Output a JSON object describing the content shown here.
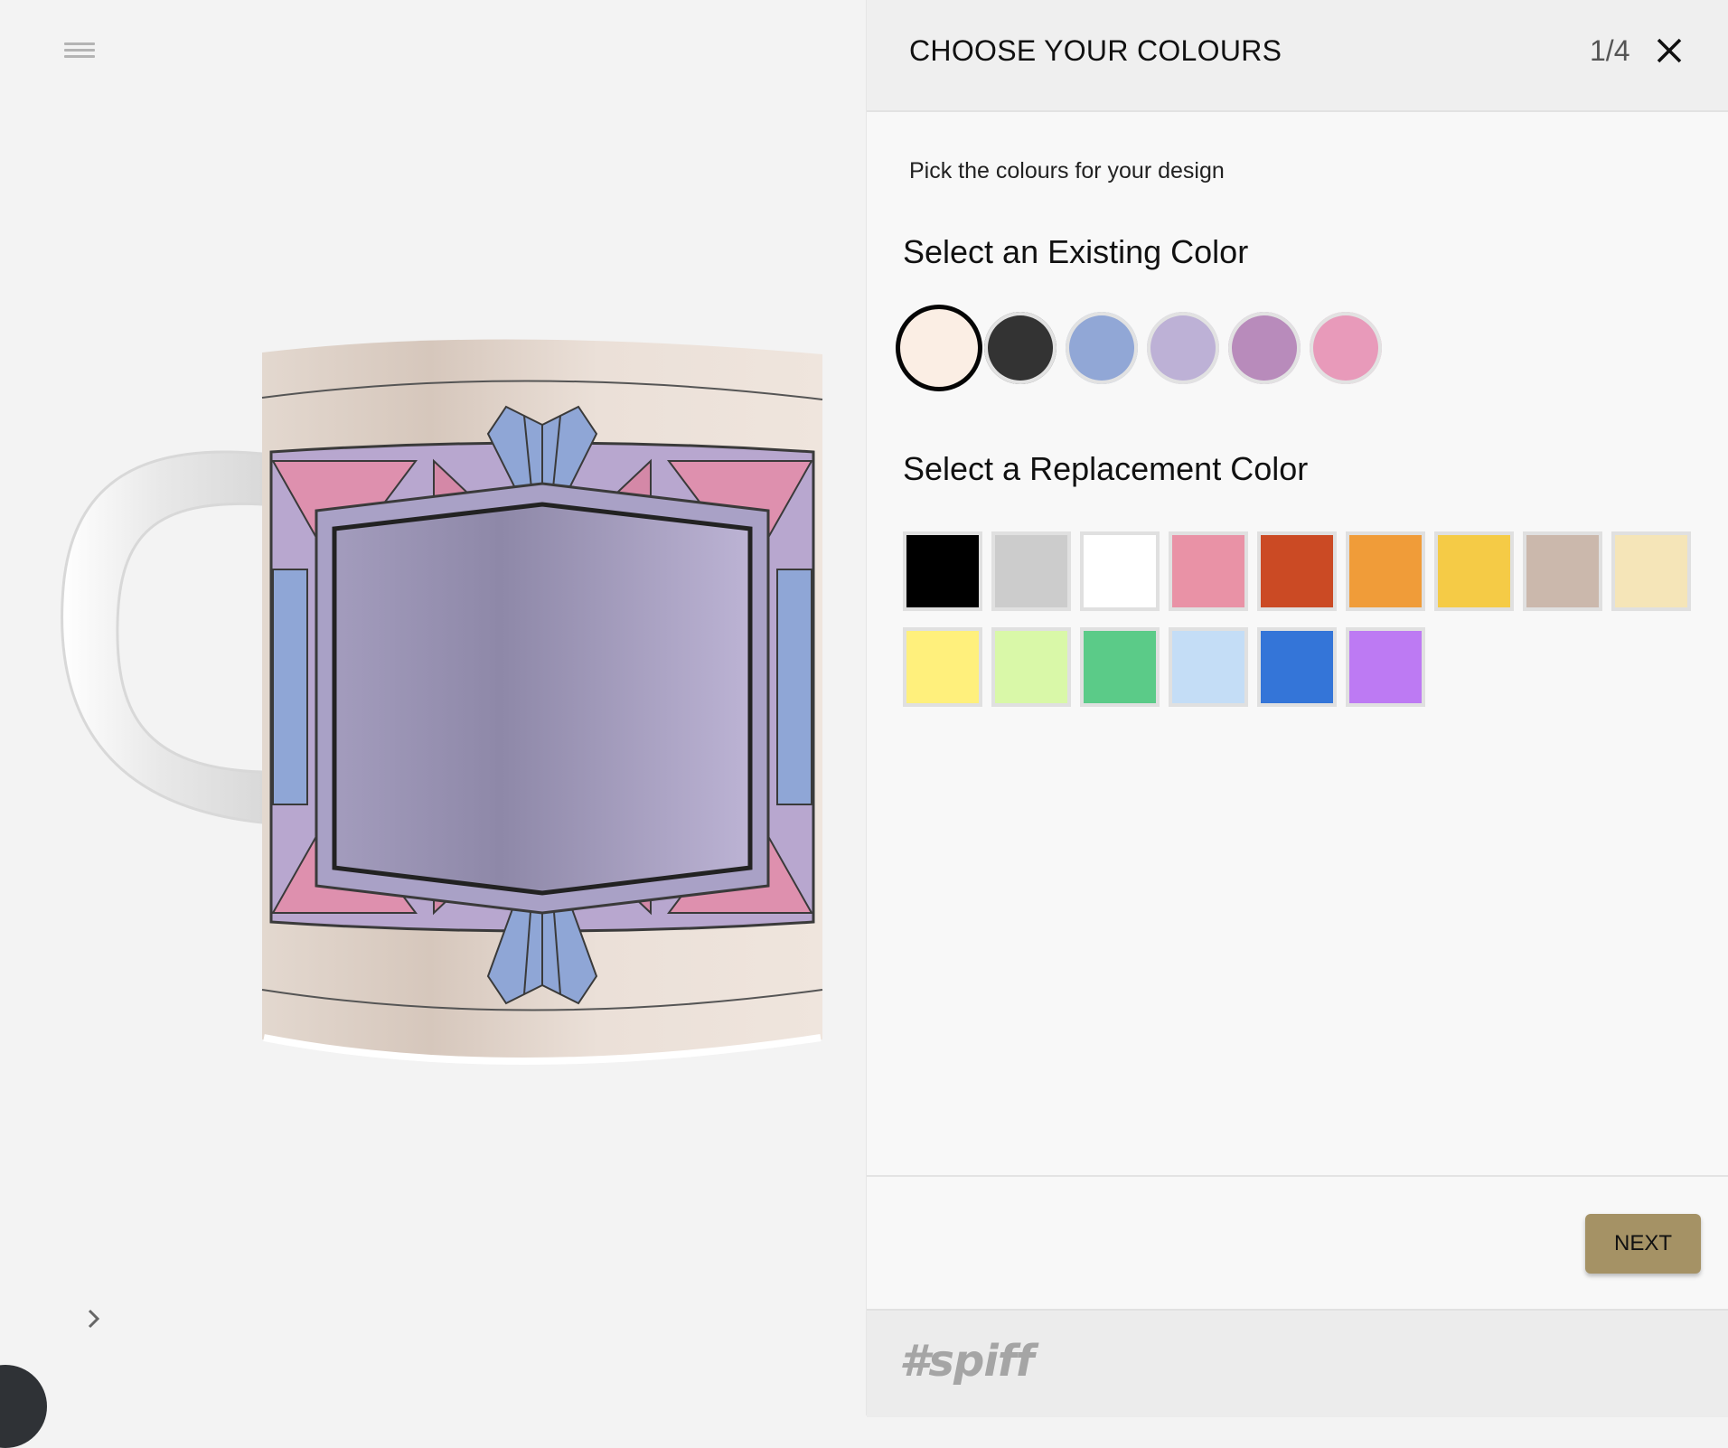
{
  "header": {
    "title": "CHOOSE YOUR COLOURS",
    "step": "1/4"
  },
  "panel": {
    "subtitle": "Pick the colours for your design",
    "existing_title": "Select an Existing Color",
    "replacement_title": "Select a Replacement Color",
    "existing_colors": [
      "#fbeee4",
      "#333333",
      "#91a7d6",
      "#bdb1d6",
      "#b88bbb",
      "#e89aba"
    ],
    "selected_existing_index": 0,
    "replacement_colors": [
      "#000000",
      "#cccccc",
      "#ffffff",
      "#e992a6",
      "#cb4a24",
      "#f09c39",
      "#f5cb46",
      "#cbb8ac",
      "#f5e5b8",
      "#fff07c",
      "#d9f8a8",
      "#5bcb88",
      "#c4ddf6",
      "#3475d8",
      "#bd7af3"
    ]
  },
  "footer": {
    "next_label": "NEXT",
    "brand": "#spiff"
  },
  "icons": {
    "menu": "hamburger-icon",
    "close": "close-icon",
    "expand": "chevron-right-icon"
  },
  "product": {
    "name": "mug-preview",
    "colors": {
      "body": "#e9ddd4",
      "frame": "#a9a1c6",
      "pink": "#e29ab6",
      "blue": "#8fa6d6",
      "lines": "#3a3a3a",
      "handle": "#f5f5f5"
    }
  }
}
